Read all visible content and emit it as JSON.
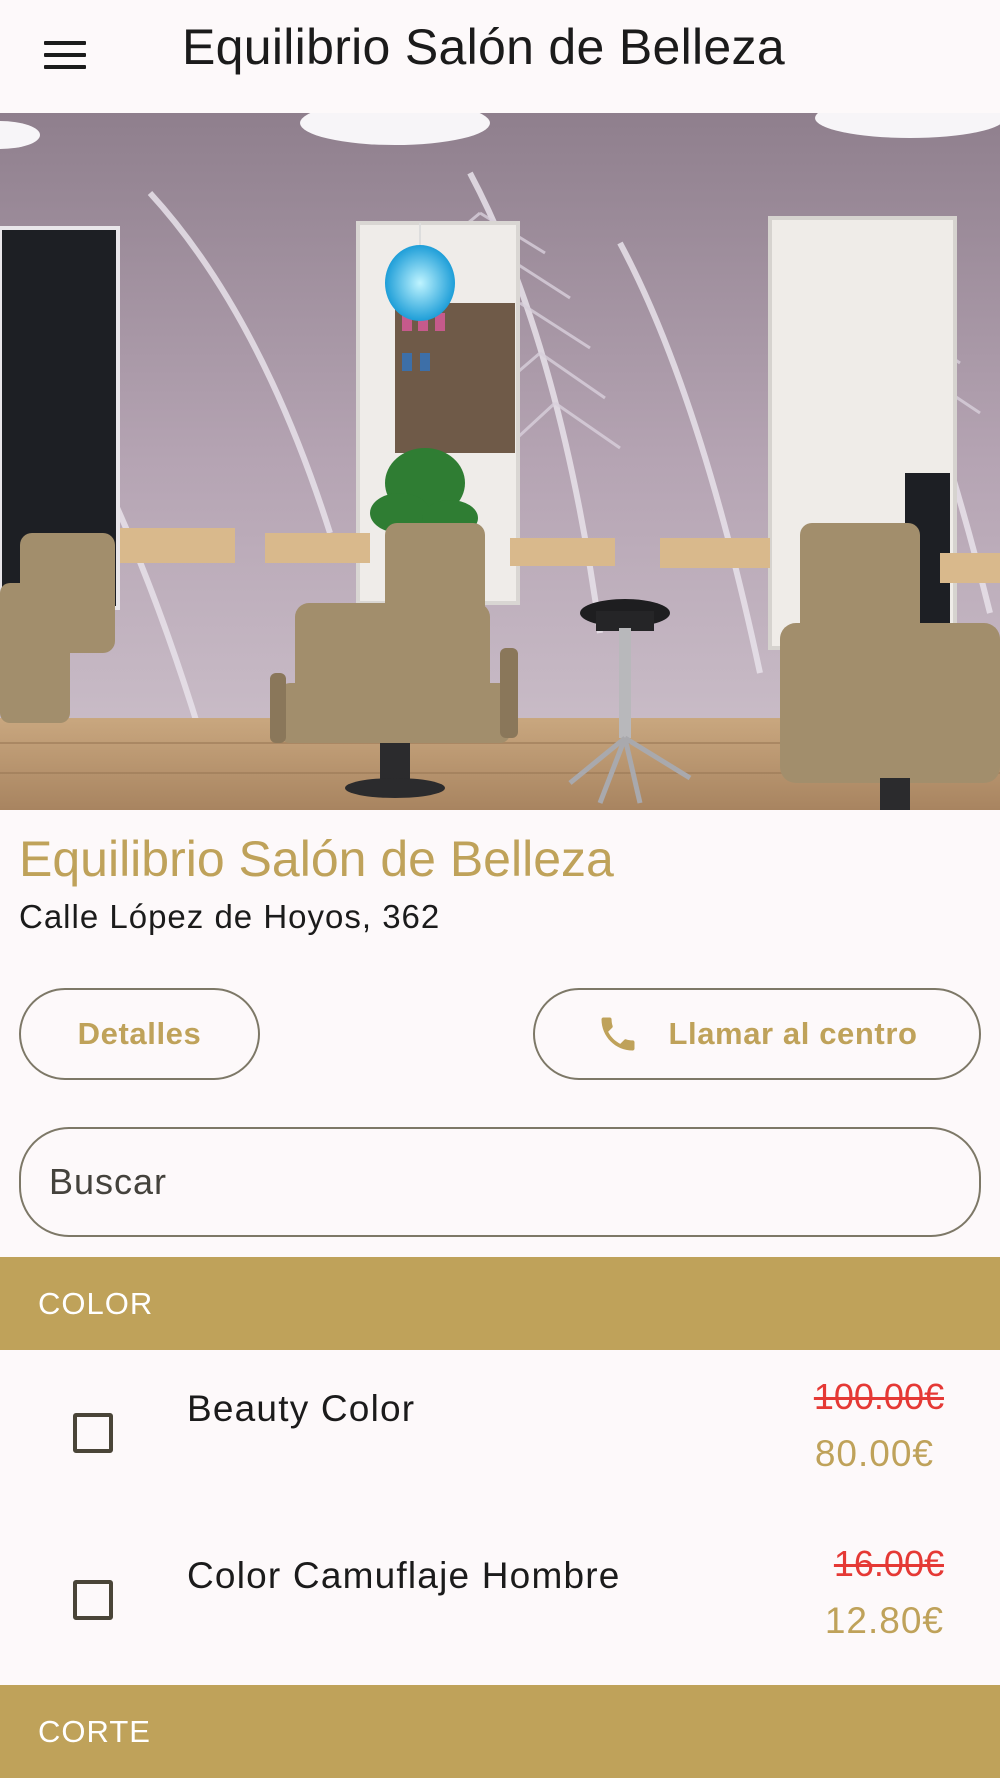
{
  "appbar": {
    "title": "Equilibrio Salón de Belleza",
    "menu_icon": "menu-icon"
  },
  "hero": {
    "icon": "salon-photo"
  },
  "salon": {
    "name": "Equilibrio Salón de Belleza",
    "address": "Calle López de Hoyos, 362"
  },
  "actions": {
    "details_label": "Detalles",
    "call_label": "Llamar al centro",
    "call_icon": "phone-icon"
  },
  "search": {
    "placeholder": "Buscar"
  },
  "categories": [
    {
      "label": "COLOR",
      "services": [
        {
          "name": "Beauty Color",
          "old_price": "100.00€",
          "price": "80.00€",
          "checked": false
        },
        {
          "name": "Color Camuflaje Hombre",
          "old_price": "16.00€",
          "price": "12.80€",
          "checked": false
        }
      ]
    },
    {
      "label": "CORTE",
      "services": []
    }
  ],
  "colors": {
    "accent": "#bfa25a",
    "strike": "#e53935",
    "background": "#fdf9fa",
    "outline": "#7d7867"
  }
}
